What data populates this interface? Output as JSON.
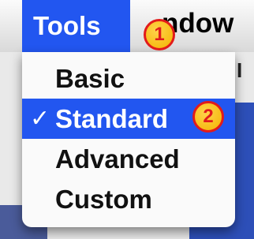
{
  "menubar": {
    "title": "Tools",
    "next_menu": "ndow",
    "background_fragment": "I"
  },
  "menu": {
    "items": [
      {
        "label": "Basic",
        "selected": false
      },
      {
        "label": "Standard",
        "selected": true,
        "checkmark": "✓"
      },
      {
        "label": "Advanced",
        "selected": false
      },
      {
        "label": "Custom",
        "selected": false
      }
    ]
  },
  "callouts": [
    {
      "number": "1"
    },
    {
      "number": "2"
    }
  ],
  "colors": {
    "highlight": "#2256f0",
    "badge_fill": "#f3b400",
    "badge_border": "#e21b1b"
  }
}
